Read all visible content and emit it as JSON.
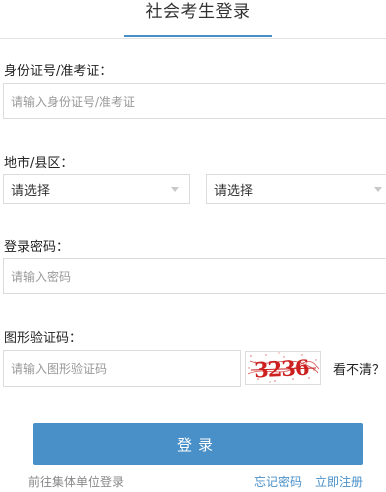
{
  "header": {
    "tab_title": "社会考生登录",
    "accent_color": "#4a90c8"
  },
  "id_field": {
    "label": "身份证号/准考证：",
    "placeholder": "请输入身份证号/准考证"
  },
  "region_field": {
    "label": "地市/县区：",
    "city_select_value": "请选择",
    "county_select_value": "请选择"
  },
  "password_field": {
    "label": "登录密码：",
    "placeholder": "请输入密码"
  },
  "captcha_field": {
    "label": "图形验证码：",
    "placeholder": "请输入图形验证码",
    "captcha_text": "3236",
    "refresh_label": "看不清？"
  },
  "login_button": {
    "label": "登录"
  },
  "footer_links": {
    "group_login": "前往集体单位登录",
    "forgot_password": "忘记密码",
    "register": "立即注册",
    "link_color": "#4a90c8",
    "muted_color": "#888888"
  }
}
